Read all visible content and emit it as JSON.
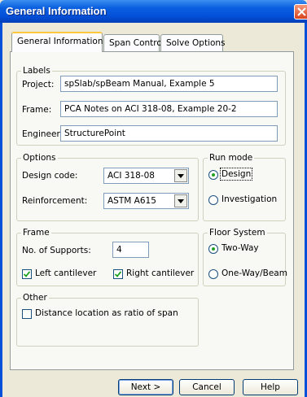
{
  "window": {
    "title": "General Information",
    "close_icon": "close-icon"
  },
  "tabs": [
    {
      "label": "General Information",
      "active": true
    },
    {
      "label": "Span Control",
      "active": false
    },
    {
      "label": "Solve Options",
      "active": false
    }
  ],
  "labels_group": {
    "legend": "Labels",
    "project": {
      "label": "Project:",
      "value": "spSlab/spBeam Manual, Example 5"
    },
    "frame": {
      "label": "Frame:",
      "value": "PCA Notes on ACI 318-08, Example 20-2"
    },
    "engineer": {
      "label": "Engineer:",
      "value": "StructurePoint"
    }
  },
  "options_group": {
    "legend": "Options",
    "design_code": {
      "label": "Design code:",
      "value": "ACI 318-08"
    },
    "reinforcement": {
      "label": "Reinforcement:",
      "value": "ASTM A615"
    }
  },
  "run_mode_group": {
    "legend": "Run mode",
    "design": {
      "label": "Design",
      "selected": true
    },
    "investigation": {
      "label": "Investigation",
      "selected": false
    }
  },
  "frame_group": {
    "legend": "Frame",
    "supports": {
      "label": "No. of Supports:",
      "value": "4"
    },
    "left_cantilever": {
      "label": "Left cantilever",
      "checked": true
    },
    "right_cantilever": {
      "label": "Right cantilever",
      "checked": true
    }
  },
  "floor_system_group": {
    "legend": "Floor System",
    "two_way": {
      "label": "Two-Way",
      "selected": true
    },
    "one_way": {
      "label": "One-Way/Beam",
      "selected": false
    }
  },
  "other_group": {
    "legend": "Other",
    "distance_ratio": {
      "label": "Distance location as ratio of span",
      "checked": false
    }
  },
  "buttons": {
    "next": "Next >",
    "cancel": "Cancel",
    "help": "Help"
  }
}
